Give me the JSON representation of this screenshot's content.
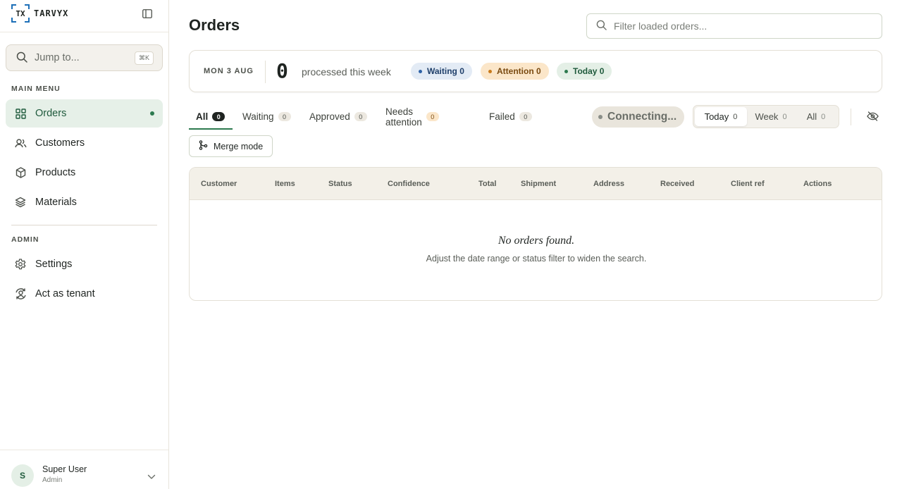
{
  "brand": {
    "mark": "TX",
    "name": "TARVYX",
    "accent": "#1d6fb8"
  },
  "search": {
    "label": "Jump to...",
    "shortcut": "⌘K"
  },
  "sidebar": {
    "main_label": "MAIN MENU",
    "main_items": [
      {
        "label": "Orders",
        "icon": "grid-icon",
        "active": true
      },
      {
        "label": "Customers",
        "icon": "users-icon"
      },
      {
        "label": "Products",
        "icon": "box-icon"
      },
      {
        "label": "Materials",
        "icon": "layers-icon"
      }
    ],
    "admin_label": "ADMIN",
    "admin_items": [
      {
        "label": "Settings",
        "icon": "gear-icon"
      },
      {
        "label": "Act as tenant",
        "icon": "user-switch-icon"
      }
    ]
  },
  "user": {
    "initial": "S",
    "name": "Super User",
    "role": "Admin"
  },
  "page": {
    "title": "Orders",
    "filter_placeholder": "Filter loaded orders..."
  },
  "summary": {
    "date": "MON 3 AUG",
    "count": "0",
    "count_label": "processed this week",
    "pills": [
      {
        "label": "Waiting 0",
        "bg": "#e3ebf5",
        "fg": "#1f3f6a",
        "dot": "#2f62a6"
      },
      {
        "label": "Attention 0",
        "bg": "#fbe6c9",
        "fg": "#7a4a10",
        "dot": "#c97a1a"
      },
      {
        "label": "Today 0",
        "bg": "#e4efe6",
        "fg": "#1f5a3c",
        "dot": "#2d7a4f"
      }
    ]
  },
  "tabs": [
    {
      "label": "All",
      "count": "0",
      "active": true
    },
    {
      "label": "Waiting",
      "count": "0"
    },
    {
      "label": "Approved",
      "count": "0"
    },
    {
      "label": "Needs attention",
      "count": "0",
      "warn": true
    },
    {
      "label": "Failed",
      "count": "0"
    }
  ],
  "connection": {
    "status": "Connecting..."
  },
  "range": [
    {
      "label": "Today",
      "count": "0",
      "active": true
    },
    {
      "label": "Week",
      "count": "0"
    },
    {
      "label": "All",
      "count": "0"
    }
  ],
  "merge": {
    "label": "Merge mode"
  },
  "table": {
    "columns": [
      "Customer",
      "Items",
      "Status",
      "Confidence",
      "Total",
      "Shipment",
      "Address",
      "Received",
      "Client ref",
      "Actions"
    ],
    "empty_title": "No orders found.",
    "empty_sub": "Adjust the date range or status filter to widen the search."
  }
}
